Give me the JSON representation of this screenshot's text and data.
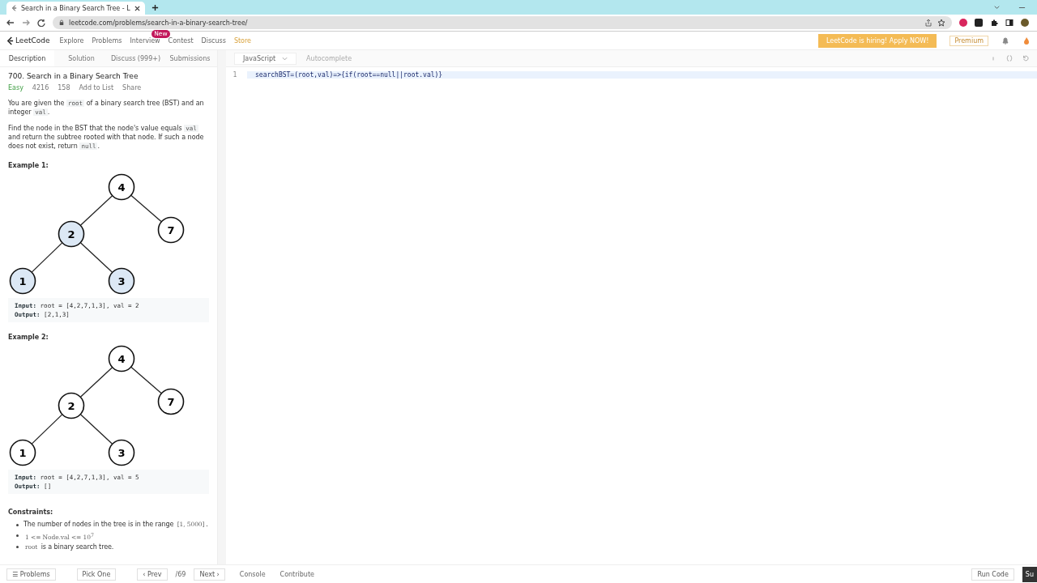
{
  "browser": {
    "tab_title": "Search in a Binary Search Tree - L",
    "url": "leetcode.com/problems/search-in-a-binary-search-tree/"
  },
  "nav": {
    "logo": "LeetCode",
    "items": [
      {
        "label": "Explore"
      },
      {
        "label": "Problems"
      },
      {
        "label": "Interview",
        "badge": "New"
      },
      {
        "label": "Contest"
      },
      {
        "label": "Discuss"
      },
      {
        "label": "Store"
      }
    ],
    "banner": "LeetCode is hiring! Apply NOW!",
    "premium": "Premium"
  },
  "tabs": [
    {
      "label": "Description",
      "selected": true
    },
    {
      "label": "Solution",
      "selected": false
    },
    {
      "label": "Discuss (999+)",
      "selected": false
    },
    {
      "label": "Submissions",
      "selected": false
    }
  ],
  "editor": {
    "language": "JavaScript",
    "autocomplete": "Autocomplete",
    "lines": [
      {
        "number": "1",
        "code": "searchBST=(root,val)=>{if(root==null||root.val)}"
      }
    ]
  },
  "problem": {
    "title": "700. Search in a Binary Search Tree",
    "difficulty": "Easy",
    "likes": "4216",
    "dislikes": "158",
    "add_to_list": "Add to List",
    "share": "Share",
    "paragraphs": [
      [
        {
          "text": "You are given the ",
          "code": false
        },
        {
          "text": "root",
          "code": true
        },
        {
          "text": " of a binary search tree (BST) and an integer ",
          "code": false
        },
        {
          "text": "val",
          "code": true
        },
        {
          "text": ".",
          "code": false
        }
      ],
      [
        {
          "text": "Find the node in the BST that the node's value equals ",
          "code": false
        },
        {
          "text": "val",
          "code": true
        },
        {
          "text": " and return the subtree rooted with that node. If such a node does not exist, return ",
          "code": false
        },
        {
          "text": "null",
          "code": true
        },
        {
          "text": ".",
          "code": false
        }
      ]
    ],
    "examples": [
      {
        "title": "Example 1:",
        "nodes": [
          {
            "value": "4",
            "highlighted": false
          },
          {
            "value": "2",
            "highlighted": true
          },
          {
            "value": "7",
            "highlighted": false
          },
          {
            "value": "1",
            "highlighted": true
          },
          {
            "value": "3",
            "highlighted": true
          }
        ],
        "input_label": "Input:",
        "input": "root = [4,2,7,1,3], val = 2",
        "output_label": "Output:",
        "output": "[2,1,3]"
      },
      {
        "title": "Example 2:",
        "nodes": [
          {
            "value": "4",
            "highlighted": false
          },
          {
            "value": "2",
            "highlighted": false
          },
          {
            "value": "7",
            "highlighted": false
          },
          {
            "value": "1",
            "highlighted": false
          },
          {
            "value": "3",
            "highlighted": false
          }
        ],
        "input_label": "Input:",
        "input": "root = [4,2,7,1,3], val = 5",
        "output_label": "Output:",
        "output": "[]"
      }
    ],
    "constraints_title": "Constraints:",
    "constraints": [
      [
        {
          "text": "The number of nodes in the tree is in the range ",
          "code": false
        },
        {
          "text": "[1, 5000]",
          "code": true
        },
        {
          "text": ".",
          "code": false
        }
      ],
      [
        {
          "text": "1 <= Node.val <= 10$^{7}$",
          "code": true
        }
      ],
      [
        {
          "text": "root",
          "code": true
        },
        {
          "text": " is a binary search tree.",
          "code": false
        }
      ]
    ]
  },
  "footer": {
    "problems": "☰ Problems",
    "pick_one": "Pick One",
    "prev": "‹ Prev",
    "page": "/69",
    "next": "Next ›",
    "console": "Console",
    "contribute": "Contribute",
    "run_code": "Run Code",
    "submit": "Su"
  }
}
